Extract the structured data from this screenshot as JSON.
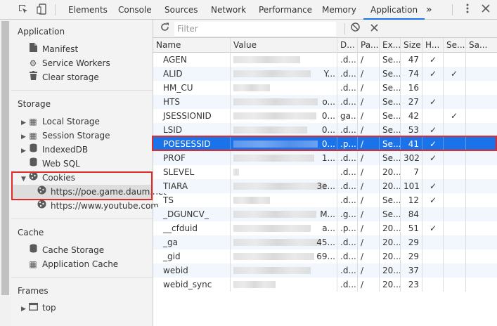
{
  "topbar": {
    "tabs": [
      "Elements",
      "Console",
      "Sources",
      "Network",
      "Performance",
      "Memory",
      "Application"
    ],
    "active_tab": "Application",
    "overflow": "»"
  },
  "sidebar": {
    "application_title": "Application",
    "application_items": [
      "Manifest",
      "Service Workers",
      "Clear storage"
    ],
    "storage_title": "Storage",
    "storage_items": [
      "Local Storage",
      "Session Storage",
      "IndexedDB",
      "Web SQL",
      "Cookies"
    ],
    "cookie_sites": [
      "https://poe.game.daum.net",
      "https://www.youtube.com"
    ],
    "cache_title": "Cache",
    "cache_items": [
      "Cache Storage",
      "Application Cache"
    ],
    "frames_title": "Frames",
    "frames_items": [
      "top"
    ]
  },
  "toolbar": {
    "filter_placeholder": "Filter"
  },
  "table": {
    "columns": [
      "Name",
      "Value",
      "D...",
      "Pa...",
      "Ex...",
      "Size",
      "H...",
      "Se...",
      "Sa..."
    ],
    "rows": [
      {
        "name": "AGEN",
        "val_tail": "",
        "domain": ".d...",
        "path": "/",
        "expires": "Se...",
        "size": "47",
        "http": "✓",
        "secure": ""
      },
      {
        "name": "ALID",
        "val_tail": "Y...",
        "domain": ".d...",
        "path": "/",
        "expires": "Se...",
        "size": "74",
        "http": "✓",
        "secure": "✓"
      },
      {
        "name": "HM_CU",
        "val_tail": "",
        "domain": ".d...",
        "path": "/",
        "expires": "Se...",
        "size": "16",
        "http": "",
        "secure": ""
      },
      {
        "name": "HTS",
        "val_tail": "o...",
        "domain": ".d...",
        "path": "/",
        "expires": "Se...",
        "size": "27",
        "http": "✓",
        "secure": ""
      },
      {
        "name": "JSESSIONID",
        "val_tail": "0...",
        "domain": "ga...",
        "path": "/",
        "expires": "Se...",
        "size": "42",
        "http": "",
        "secure": "✓"
      },
      {
        "name": "LSID",
        "val_tail": "0...",
        "domain": ".d...",
        "path": "/",
        "expires": "Se...",
        "size": "53",
        "http": "✓",
        "secure": ""
      },
      {
        "name": "POESESSID",
        "val_tail": "0...",
        "domain": ".p...",
        "path": "/",
        "expires": "Se...",
        "size": "41",
        "http": "✓",
        "secure": ""
      },
      {
        "name": "PROF",
        "val_tail": "1...",
        "domain": ".d...",
        "path": "/",
        "expires": "Se...",
        "size": "302",
        "http": "✓",
        "secure": ""
      },
      {
        "name": "SLEVEL",
        "val_tail": "",
        "domain": ".d...",
        "path": "/",
        "expires": "20...",
        "size": "7",
        "http": "",
        "secure": ""
      },
      {
        "name": "TIARA",
        "val_tail": "3e...",
        "domain": ".d...",
        "path": "/",
        "expires": "20...",
        "size": "101",
        "http": "✓",
        "secure": ""
      },
      {
        "name": "TS",
        "val_tail": "",
        "domain": ".d...",
        "path": "/",
        "expires": "Se...",
        "size": "12",
        "http": "✓",
        "secure": ""
      },
      {
        "name": "_DGUNCV_",
        "val_tail": "M...",
        "domain": ".g...",
        "path": "/",
        "expires": "Se...",
        "size": "84",
        "http": "",
        "secure": ""
      },
      {
        "name": "__cfduid",
        "val_tail": "a...",
        "domain": ".p...",
        "path": "/",
        "expires": "20...",
        "size": "51",
        "http": "✓",
        "secure": ""
      },
      {
        "name": "_ga",
        "val_tail": "45...",
        "domain": ".d...",
        "path": "/",
        "expires": "20...",
        "size": "29",
        "http": "",
        "secure": ""
      },
      {
        "name": "_gid",
        "val_tail": "69...",
        "domain": ".d...",
        "path": "/",
        "expires": "20...",
        "size": "29",
        "http": "",
        "secure": ""
      },
      {
        "name": "webid",
        "val_tail": "",
        "domain": ".d...",
        "path": "/",
        "expires": "20...",
        "size": "37",
        "http": "",
        "secure": ""
      },
      {
        "name": "webid_sync",
        "val_tail": "",
        "domain": ".d...",
        "path": "/",
        "expires": "20...",
        "size": "23",
        "http": "",
        "secure": ""
      }
    ],
    "selected_index": 6
  },
  "colors": {
    "selection": "#1a73e8",
    "highlight_box": "#e02b2b",
    "active_tab_underline": "#1a73e8"
  }
}
